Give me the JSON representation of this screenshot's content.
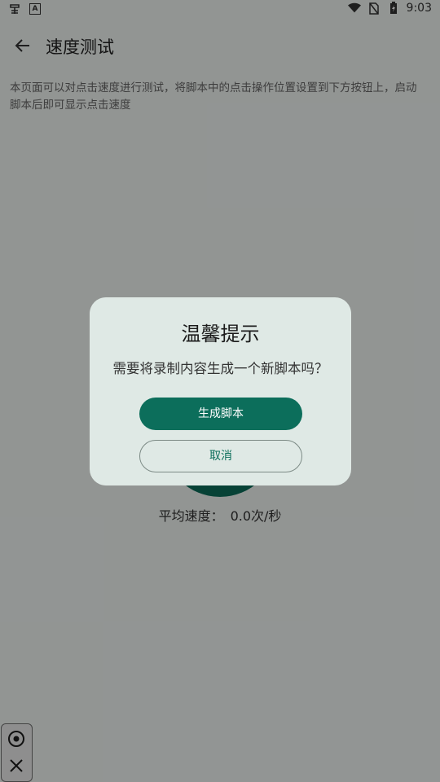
{
  "status_bar": {
    "time": "9:03",
    "left_icons": [
      "bug-app-icon",
      "a-keyboard-icon"
    ],
    "right_icons": [
      "wifi-icon",
      "no-sim-icon",
      "battery-charging-icon"
    ]
  },
  "app_bar": {
    "title": "速度测试",
    "back_icon": "arrow-left-icon"
  },
  "description": "本页面可以对点击速度进行测试，将脚本中的点击操作位置设置到下方按钮上，启动脚本后即可显示点击速度",
  "speed": {
    "label": "平均速度：",
    "value": "0.0次/秒"
  },
  "dialog": {
    "title": "温馨提示",
    "message": "需要将录制内容生成一个新脚本吗？",
    "confirm_label": "生成脚本",
    "cancel_label": "取消"
  },
  "floating_panel": {
    "icons": [
      "target-icon",
      "close-icon"
    ]
  },
  "colors": {
    "accent": "#0c6e5b",
    "dialog_bg": "#dfe9e5",
    "scrim": "rgba(0,0,0,0.40)"
  }
}
